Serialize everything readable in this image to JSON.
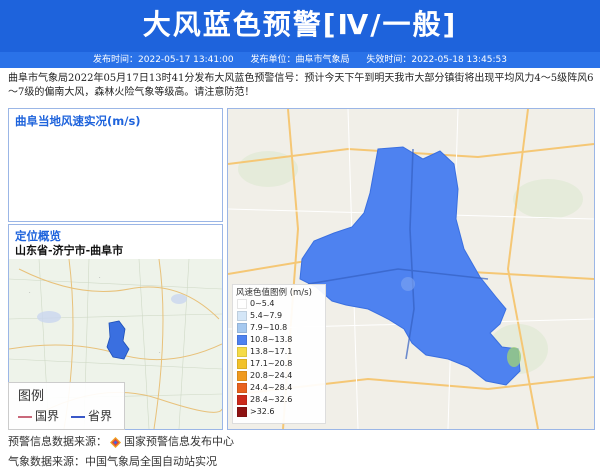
{
  "header": {
    "title": "大风蓝色预警[Ⅳ/一般]",
    "publish_time": "发布时间：2022-05-17 13:41:00",
    "publisher": "发布单位：曲阜市气象局",
    "expire_time": "失效时间：2022-05-18 13:45:53"
  },
  "description": "曲阜市气象局2022年05月17日13时41分发布大风蓝色预警信号：预计今天下午到明天我市大部分镇街将出现平均风力4～5级阵风6～7级的偏南大风，森林火险气象等级高。请注意防范！",
  "wind_panel": {
    "title": "曲阜当地风速实况(m/s)"
  },
  "location_panel": {
    "title": "定位概览",
    "subtitle": "山东省-济宁市-曲阜市",
    "legend_title": "图例",
    "legend_items": [
      {
        "label": "国界",
        "color": "#c9687a"
      },
      {
        "label": "省界",
        "color": "#3a58c8"
      }
    ]
  },
  "wind_legend": {
    "title": "风速色值图例 (m/s)",
    "items": [
      {
        "label": "0~5.4",
        "color": "#ffffff"
      },
      {
        "label": "5.4~7.9",
        "color": "#d4e6f7"
      },
      {
        "label": "7.9~10.8",
        "color": "#a5c8ef"
      },
      {
        "label": "10.8~13.8",
        "color": "#4e82f0"
      },
      {
        "label": "13.8~17.1",
        "color": "#f5dc47"
      },
      {
        "label": "17.1~20.8",
        "color": "#f2c22a"
      },
      {
        "label": "20.8~24.4",
        "color": "#f09a1e"
      },
      {
        "label": "24.4~28.4",
        "color": "#e8611e"
      },
      {
        "label": "28.4~32.6",
        "color": "#cc2a1c"
      },
      {
        "label": ">32.6",
        "color": "#8e1212"
      }
    ]
  },
  "footer": {
    "source1_label": "预警信息数据来源：",
    "source1_value": "国家预警信息发布中心",
    "source2": "气象数据来源：中国气象局全国自动站实况"
  }
}
